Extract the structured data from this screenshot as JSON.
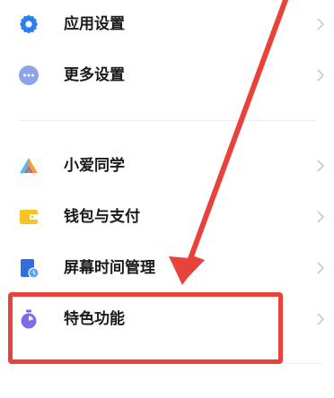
{
  "settings_items": [
    {
      "label": "应用设置",
      "icon": "gear-icon",
      "icon_color": "#2a7ff0"
    },
    {
      "label": "更多设置",
      "icon": "more-dots-icon",
      "icon_color": "#8fa4e8"
    },
    {
      "label": "小爱同学",
      "icon": "xiaoai-assistant-icon",
      "icon_color": "#f2a03a"
    },
    {
      "label": "钱包与支付",
      "icon": "wallet-icon",
      "icon_color": "#f7c325"
    },
    {
      "label": "屏幕时间管理",
      "icon": "screen-time-icon",
      "icon_color": "#2f6fe0"
    },
    {
      "label": "特色功能",
      "icon": "special-features-icon",
      "icon_color": "#7a6ee6"
    }
  ],
  "chevron_icon": "chevron-right-icon",
  "annotation": {
    "color": "#e8433a",
    "highlighted_item": "特色功能"
  }
}
